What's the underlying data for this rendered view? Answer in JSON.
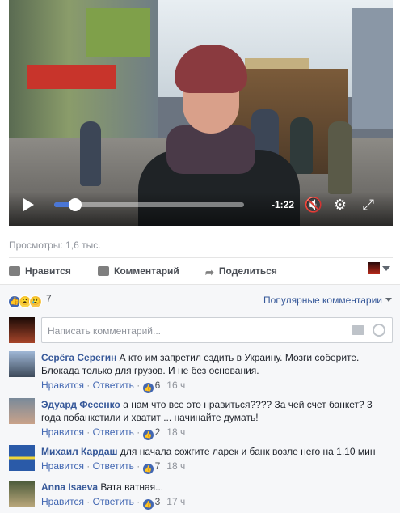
{
  "video": {
    "time_remaining": "-1:22",
    "progress": 0.11
  },
  "views": "Просмотры: 1,6 тыс.",
  "actions": {
    "like": "Нравится",
    "comment": "Комментарий",
    "share": "Поделиться"
  },
  "reactions": {
    "count": "7",
    "sort_label": "Популярные комментарии"
  },
  "composer": {
    "placeholder": "Написать комментарий..."
  },
  "comments": [
    {
      "name": "Серёга Серегин",
      "text": "А кто им запретил ездить в Украину. Мозги соберите. Блокада только для грузов. И не без основания.",
      "like": "Нравится",
      "reply": "Ответить",
      "likes": "6",
      "time": "16 ч"
    },
    {
      "name": "Эдуард Фесенко",
      "text": "а нам что все это нравиться???? За чей счет банкет? 3 года побанкетили и хватит ... начинайте думать!",
      "like": "Нравится",
      "reply": "Ответить",
      "likes": "2",
      "time": "18 ч"
    },
    {
      "name": "Михаил Кардаш",
      "text": "для начала сожгите ларек и банк возле него на 1.10 мин",
      "like": "Нравится",
      "reply": "Ответить",
      "likes": "7",
      "time": "18 ч"
    },
    {
      "name": "Anna Isaeva",
      "text": "Вата ватная...",
      "like": "Нравится",
      "reply": "Ответить",
      "likes": "3",
      "time": "17 ч"
    }
  ],
  "colors": {
    "link": "#365899",
    "like_blue": "#4267b2",
    "progress_blue": "#4a76d6"
  }
}
